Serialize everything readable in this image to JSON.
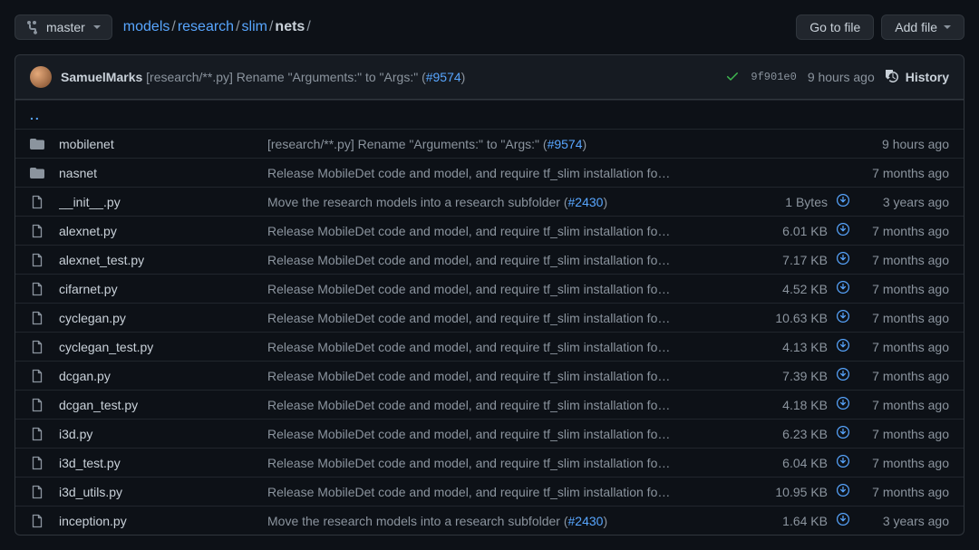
{
  "branch": "master",
  "breadcrumbs": {
    "parts": [
      "models",
      "research",
      "slim"
    ],
    "current": "nets"
  },
  "buttons": {
    "go_to_file": "Go to file",
    "add_file": "Add file"
  },
  "commit": {
    "author": "SamuelMarks",
    "message_prefix": "[research/**.py] Rename \"Arguments:\" to \"Args:\" (",
    "pr": "#9574",
    "message_suffix": ")",
    "sha": "9f901e0",
    "age": "9 hours ago",
    "history_label": "History"
  },
  "parent_link": "..",
  "files": [
    {
      "type": "dir",
      "name": "mobilenet",
      "msg_prefix": "[research/**.py] Rename \"Arguments:\" to \"Args:\" (",
      "pr": "#9574",
      "msg_suffix": ")",
      "size": "",
      "download": false,
      "age": "9 hours ago"
    },
    {
      "type": "dir",
      "name": "nasnet",
      "msg_prefix": "Release MobileDet code and model, and require tf_slim installation fo…",
      "pr": "",
      "msg_suffix": "",
      "size": "",
      "download": false,
      "age": "7 months ago"
    },
    {
      "type": "file",
      "name": "__init__.py",
      "msg_prefix": "Move the research models into a research subfolder (",
      "pr": "#2430",
      "msg_suffix": ")",
      "size": "1 Bytes",
      "download": true,
      "age": "3 years ago"
    },
    {
      "type": "file",
      "name": "alexnet.py",
      "msg_prefix": "Release MobileDet code and model, and require tf_slim installation fo…",
      "pr": "",
      "msg_suffix": "",
      "size": "6.01 KB",
      "download": true,
      "age": "7 months ago"
    },
    {
      "type": "file",
      "name": "alexnet_test.py",
      "msg_prefix": "Release MobileDet code and model, and require tf_slim installation fo…",
      "pr": "",
      "msg_suffix": "",
      "size": "7.17 KB",
      "download": true,
      "age": "7 months ago"
    },
    {
      "type": "file",
      "name": "cifarnet.py",
      "msg_prefix": "Release MobileDet code and model, and require tf_slim installation fo…",
      "pr": "",
      "msg_suffix": "",
      "size": "4.52 KB",
      "download": true,
      "age": "7 months ago"
    },
    {
      "type": "file",
      "name": "cyclegan.py",
      "msg_prefix": "Release MobileDet code and model, and require tf_slim installation fo…",
      "pr": "",
      "msg_suffix": "",
      "size": "10.63 KB",
      "download": true,
      "age": "7 months ago"
    },
    {
      "type": "file",
      "name": "cyclegan_test.py",
      "msg_prefix": "Release MobileDet code and model, and require tf_slim installation fo…",
      "pr": "",
      "msg_suffix": "",
      "size": "4.13 KB",
      "download": true,
      "age": "7 months ago"
    },
    {
      "type": "file",
      "name": "dcgan.py",
      "msg_prefix": "Release MobileDet code and model, and require tf_slim installation fo…",
      "pr": "",
      "msg_suffix": "",
      "size": "7.39 KB",
      "download": true,
      "age": "7 months ago"
    },
    {
      "type": "file",
      "name": "dcgan_test.py",
      "msg_prefix": "Release MobileDet code and model, and require tf_slim installation fo…",
      "pr": "",
      "msg_suffix": "",
      "size": "4.18 KB",
      "download": true,
      "age": "7 months ago"
    },
    {
      "type": "file",
      "name": "i3d.py",
      "msg_prefix": "Release MobileDet code and model, and require tf_slim installation fo…",
      "pr": "",
      "msg_suffix": "",
      "size": "6.23 KB",
      "download": true,
      "age": "7 months ago"
    },
    {
      "type": "file",
      "name": "i3d_test.py",
      "msg_prefix": "Release MobileDet code and model, and require tf_slim installation fo…",
      "pr": "",
      "msg_suffix": "",
      "size": "6.04 KB",
      "download": true,
      "age": "7 months ago"
    },
    {
      "type": "file",
      "name": "i3d_utils.py",
      "msg_prefix": "Release MobileDet code and model, and require tf_slim installation fo…",
      "pr": "",
      "msg_suffix": "",
      "size": "10.95 KB",
      "download": true,
      "age": "7 months ago"
    },
    {
      "type": "file",
      "name": "inception.py",
      "msg_prefix": "Move the research models into a research subfolder (",
      "pr": "#2430",
      "msg_suffix": ")",
      "size": "1.64 KB",
      "download": true,
      "age": "3 years ago"
    }
  ]
}
